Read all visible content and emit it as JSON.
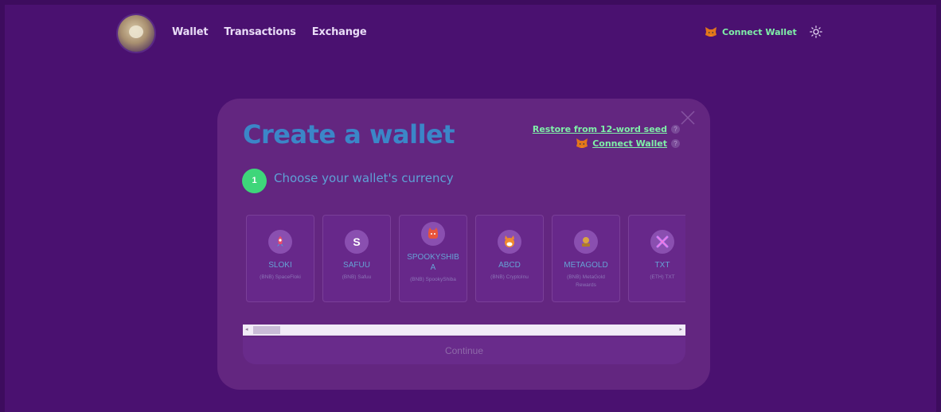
{
  "header": {
    "nav": [
      "Wallet",
      "Transactions",
      "Exchange"
    ],
    "connect_label": "Connect Wallet"
  },
  "modal": {
    "title": "Create a wallet",
    "restore_link": "Restore from 12-word seed",
    "connect_link": "Connect Wallet",
    "help_mark": "?",
    "step_number": "1",
    "step_label": "Choose your wallet's currency",
    "continue_label": "Continue",
    "scroll_left": "◂",
    "scroll_right": "▸"
  },
  "currencies": [
    {
      "symbol": "SLOKI",
      "desc": "(BNB) SpaceFloki",
      "icon": "rocket-icon"
    },
    {
      "symbol": "SAFUU",
      "desc": "(BNB) Safuu",
      "icon": "s-letter-icon",
      "glyph": "S"
    },
    {
      "symbol": "SPOOKYSHIBA",
      "desc": "(BNB) SpookyShiba",
      "icon": "shiba-icon"
    },
    {
      "symbol": "ABCD",
      "desc": "(BNB) CryptoInu",
      "icon": "dog-icon"
    },
    {
      "symbol": "METAGOLD",
      "desc": "(BNB) MetaGold Rewards",
      "icon": "gold-icon"
    },
    {
      "symbol": "TXT",
      "desc": "(ETH) TXT",
      "icon": "txt-icon"
    }
  ],
  "colors": {
    "background": "#4a1170",
    "modal": "#632680",
    "accent_green": "#7ff0a8",
    "title_blue": "#3b86c8"
  }
}
